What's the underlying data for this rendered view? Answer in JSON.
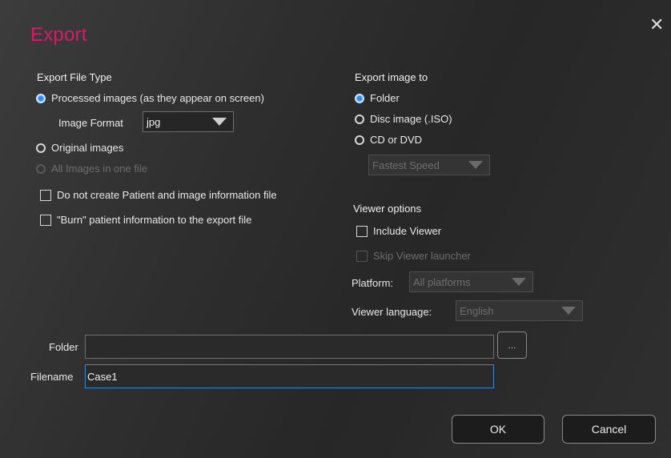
{
  "dialog": {
    "title": "Export",
    "close_glyph": "✕"
  },
  "export_file_type": {
    "heading": "Export File Type",
    "processed_label": "Processed images (as they appear on screen)",
    "image_format_label": "Image Format",
    "image_format_value": "jpg",
    "original_label": "Original images",
    "all_in_one_label": "All Images in one file",
    "no_patient_info_label": "Do not create Patient and image information file",
    "burn_label": "\"Burn\" patient information to the export file"
  },
  "export_image_to": {
    "heading": "Export image to",
    "folder_label": "Folder",
    "disc_label": "Disc image (.ISO)",
    "cd_label": "CD or DVD",
    "speed_value": "Fastest Speed"
  },
  "viewer_options": {
    "heading": "Viewer options",
    "include_viewer_label": "Include Viewer",
    "skip_launcher_label": "Skip Viewer launcher",
    "platform_label": "Platform:",
    "platform_value": "All platforms",
    "language_label": "Viewer language:",
    "language_value": "English"
  },
  "destination": {
    "folder_label": "Folder",
    "folder_value": "",
    "browse_label": "...",
    "filename_label": "Filename",
    "filename_value": "Case1"
  },
  "buttons": {
    "ok": "OK",
    "cancel": "Cancel"
  },
  "colors": {
    "title": "#d81b68",
    "radio_selected": "#2f8bf0",
    "focus_border": "#3f86cc"
  }
}
